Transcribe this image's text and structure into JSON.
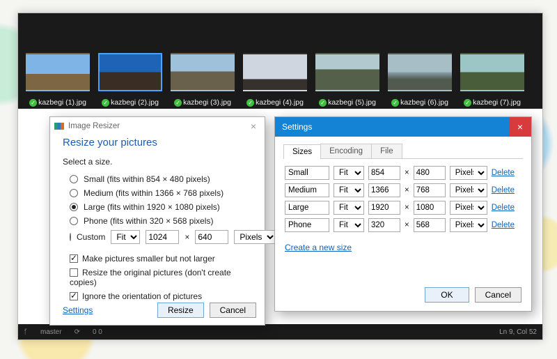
{
  "strip": {
    "items": [
      {
        "file": "kazbegi (1).jpg"
      },
      {
        "file": "kazbegi (2).jpg"
      },
      {
        "file": "kazbegi (3).jpg"
      },
      {
        "file": "kazbegi (4).jpg"
      },
      {
        "file": "kazbegi (5).jpg"
      },
      {
        "file": "kazbegi (6).jpg"
      },
      {
        "file": "kazbegi (7).jpg"
      }
    ]
  },
  "resize": {
    "window_title": "Image Resizer",
    "heading": "Resize your pictures",
    "select_label": "Select a size.",
    "sizes": [
      {
        "id": "small",
        "label": "Small (fits within 854 × 480 pixels)",
        "checked": false
      },
      {
        "id": "medium",
        "label": "Medium (fits within 1366 × 768 pixels)",
        "checked": false
      },
      {
        "id": "large",
        "label": "Large (fits within 1920 × 1080 pixels)",
        "checked": true
      },
      {
        "id": "phone",
        "label": "Phone (fits within 320 × 568 pixels)",
        "checked": false
      }
    ],
    "custom_label": "Custom",
    "custom_mode": "Fit",
    "custom_w": "1024",
    "custom_x": "×",
    "custom_h": "640",
    "custom_unit": "Pixels",
    "opts": [
      {
        "label": "Make pictures smaller but not larger",
        "checked": true
      },
      {
        "label": "Resize the original pictures (don't create copies)",
        "checked": false
      },
      {
        "label": "Ignore the orientation of pictures",
        "checked": true
      }
    ],
    "settings_link": "Settings",
    "btn_resize": "Resize",
    "btn_cancel": "Cancel"
  },
  "settings": {
    "title": "Settings",
    "tabs": [
      "Sizes",
      "Encoding",
      "File"
    ],
    "active_tab": 0,
    "rows": [
      {
        "name": "Small",
        "mode": "Fit",
        "w": "854",
        "h": "480",
        "unit": "Pixels"
      },
      {
        "name": "Medium",
        "mode": "Fit",
        "w": "1366",
        "h": "768",
        "unit": "Pixels"
      },
      {
        "name": "Large",
        "mode": "Fit",
        "w": "1920",
        "h": "1080",
        "unit": "Pixels"
      },
      {
        "name": "Phone",
        "mode": "Fit",
        "w": "320",
        "h": "568",
        "unit": "Pixels"
      }
    ],
    "times": "×",
    "delete_label": "Delete",
    "new_link": "Create a new size",
    "btn_ok": "OK",
    "btn_cancel": "Cancel"
  },
  "statusbar": {
    "branch": "master",
    "counts": "0  0",
    "pos": "Ln 9, Col 52"
  }
}
